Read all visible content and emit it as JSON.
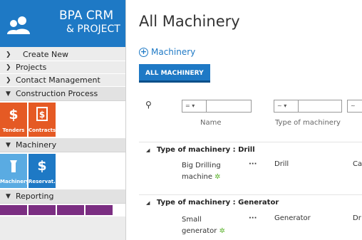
{
  "brand": {
    "line1": "BPA CRM",
    "line2": "& PROJECT",
    "color": "#1e79c5"
  },
  "sidebar": {
    "items": [
      {
        "label": "Create New"
      },
      {
        "label": "Projects"
      },
      {
        "label": "Contact Management"
      }
    ],
    "sections": [
      {
        "label": "Construction Process",
        "tiles": [
          {
            "label": "Tenders",
            "icon": "dollar-icon",
            "color": "#e55a24"
          },
          {
            "label": "Contracts",
            "icon": "contract-icon",
            "color": "#e55a24"
          }
        ]
      },
      {
        "label": "Machinery",
        "tiles": [
          {
            "label": "Machinery",
            "icon": "machine-icon",
            "color": "#5aabe2"
          },
          {
            "label": "Reservat...",
            "icon": "dollar-icon",
            "color": "#1e79c5"
          }
        ]
      },
      {
        "label": "Reporting",
        "tiles": []
      }
    ]
  },
  "main": {
    "title": "All Machinery",
    "add_label": "Machinery",
    "tab": "ALL MACHINERY",
    "filters": [
      {
        "op": "= ▾"
      },
      {
        "op": "~ ▾"
      },
      {
        "op": "~"
      }
    ],
    "columns": [
      "Name",
      "Type of machinery"
    ],
    "groups": [
      {
        "title": "Type of machinery : Drill",
        "rows": [
          {
            "name_line1": "Big Drilling",
            "name_line2": "machine",
            "more": "···",
            "type": "Drill",
            "extra": "Ca"
          }
        ]
      },
      {
        "title": "Type of machinery : Generator",
        "rows": [
          {
            "name_line1": "Small",
            "name_line2": "generator",
            "more": "···",
            "type": "Generator",
            "extra": "Dr"
          }
        ]
      }
    ],
    "star": "✲"
  }
}
